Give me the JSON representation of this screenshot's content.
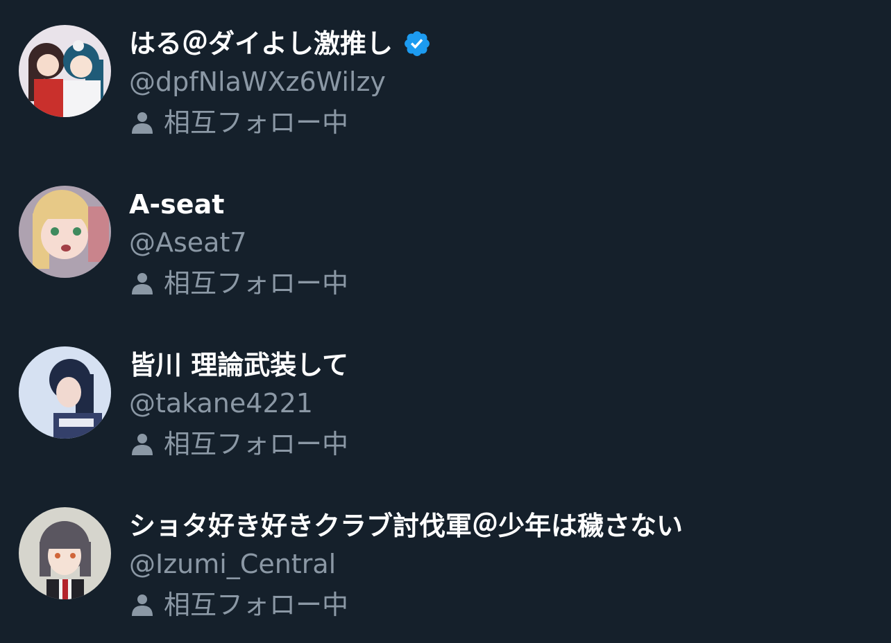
{
  "colors": {
    "background": "#15202b",
    "primary_text": "#ffffff",
    "secondary_text": "#8b98a5",
    "verified_blue": "#1d9bf0"
  },
  "users": [
    {
      "display_name": "はる＠ダイよし激推し",
      "handle": "@dpfNlaWXz6Wilzy",
      "verified": true,
      "badge_icon": "verified-badge-icon",
      "status_icon": "person-icon",
      "status": "相互フォロー中"
    },
    {
      "display_name": "A-seat",
      "handle": "@Aseat7",
      "verified": false,
      "status_icon": "person-icon",
      "status": "相互フォロー中"
    },
    {
      "display_name": "皆川 理論武装して",
      "handle": "@takane4221",
      "verified": false,
      "status_icon": "person-icon",
      "status": "相互フォロー中"
    },
    {
      "display_name": "ショタ好き好きクラブ討伐軍＠少年は穢さない",
      "handle": "@Izumi_Central",
      "verified": false,
      "status_icon": "person-icon",
      "status": "相互フォロー中"
    }
  ]
}
